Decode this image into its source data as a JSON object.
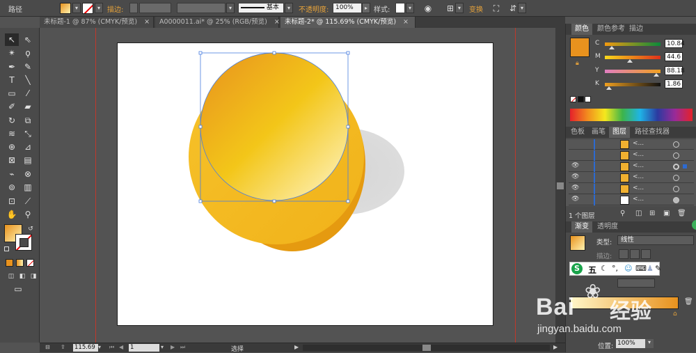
{
  "control_bar": {
    "path_label": "路径",
    "stroke_label": "描边:",
    "stroke_style": "基本",
    "opacity_label": "不透明度:",
    "opacity_value": "100%",
    "style_label": "样式:",
    "transform_label": "变换"
  },
  "tabs": [
    {
      "label": "未标题-1 @ 87% (CMYK/预览)",
      "close": "×"
    },
    {
      "label": "A0000011.ai* @ 25% (RGB/预览)",
      "close": "×"
    },
    {
      "label": "未标题-2* @ 115.69% (CMYK/预览)",
      "close": "×"
    }
  ],
  "color_panel": {
    "tabs": [
      "颜色",
      "颜色参考",
      "描边"
    ],
    "swatch_color": "#e8921e",
    "channels": [
      {
        "letter": "C",
        "value": "10.84"
      },
      {
        "letter": "M",
        "value": "44.6"
      },
      {
        "letter": "Y",
        "value": "88.18"
      },
      {
        "letter": "K",
        "value": "1.86"
      }
    ]
  },
  "layers_panel": {
    "tabs": [
      "色板",
      "画笔",
      "图层",
      "路径查找器"
    ],
    "rows": [
      {
        "name": "<...",
        "thumb": "#f0b030"
      },
      {
        "name": "<...",
        "thumb": "#f0b030"
      },
      {
        "name": "<...",
        "thumb": "#f0b030"
      },
      {
        "name": "<...",
        "thumb": "#f0b030"
      },
      {
        "name": "<...",
        "thumb": "#f0b030"
      },
      {
        "name": "<...",
        "thumb": "#ffffff"
      }
    ],
    "footer": "1 个图层"
  },
  "gradient_panel": {
    "tabs": [
      "渐变",
      "透明度"
    ],
    "type_label": "类型:",
    "type_value": "线性",
    "stroke_label": "描边:",
    "location_label": "位置:",
    "location_value": "100%"
  },
  "status_bar": {
    "zoom": "115.69",
    "page": "1",
    "mode": "选择"
  },
  "ime": {
    "logo": "S",
    "mode": "五"
  },
  "watermark": {
    "brand_left": "Bai",
    "brand_right": "经验",
    "url": "jingyan.baidu.com"
  },
  "colors": {
    "gradient_start": "#e8921e",
    "gradient_mid": "#f3c619",
    "gradient_end": "#fff6c8",
    "coin_back": "#e59a10",
    "selection": "#4a7ee0"
  }
}
